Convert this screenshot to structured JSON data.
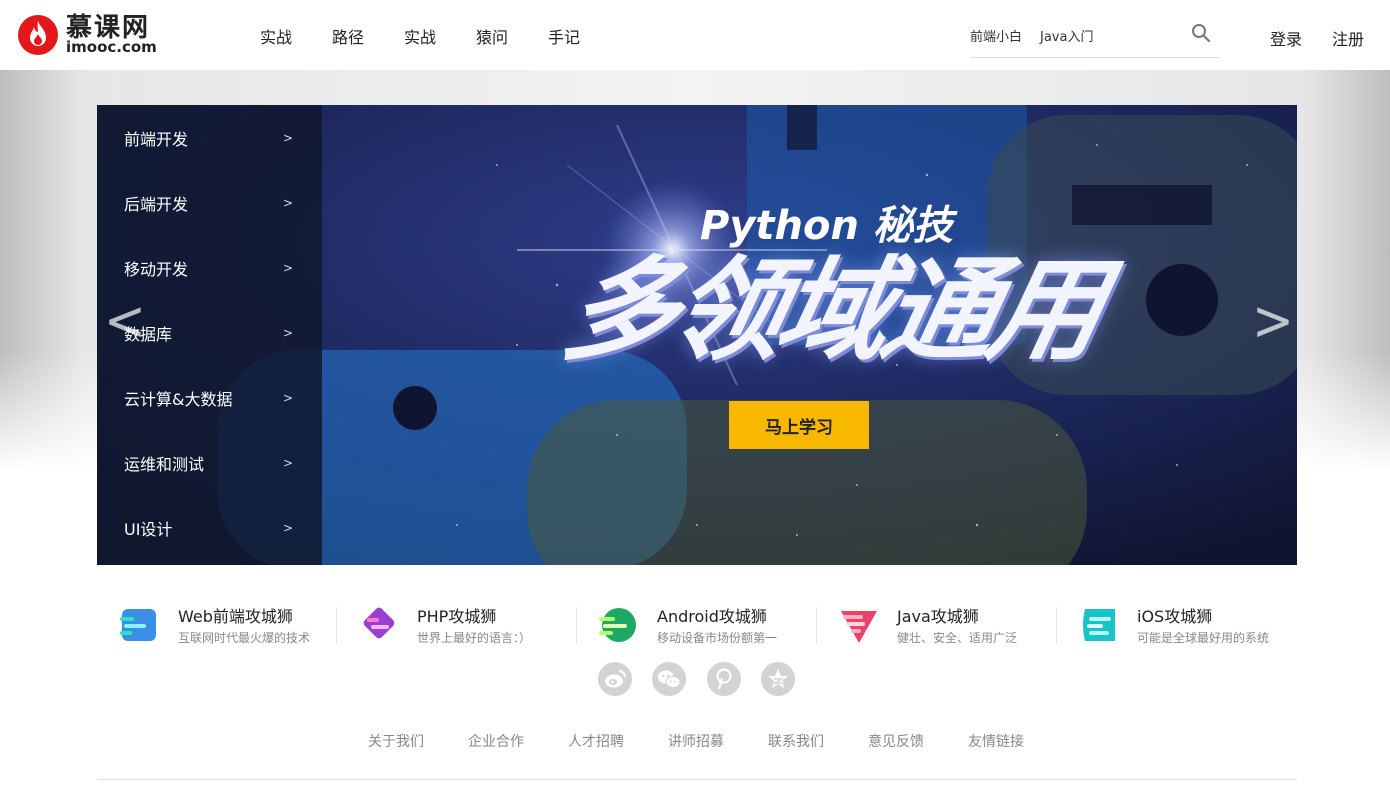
{
  "header": {
    "logo_cn": "慕课网",
    "logo_en": "imooc.com",
    "nav": [
      "实战",
      "路径",
      "实战",
      "猿问",
      "手记"
    ],
    "search": {
      "hot_tags": [
        "前端小白",
        "Java入门"
      ],
      "placeholder": ""
    },
    "login": "登录",
    "register": "注册"
  },
  "sidebar": {
    "items": [
      {
        "label": "前端开发",
        "arrow": ">"
      },
      {
        "label": "后端开发",
        "arrow": ">"
      },
      {
        "label": "移动开发",
        "arrow": ">"
      },
      {
        "label": "数据库",
        "arrow": ">"
      },
      {
        "label": "云计算&大数据",
        "arrow": ">"
      },
      {
        "label": "运维和测试",
        "arrow": ">"
      },
      {
        "label": "UI设计",
        "arrow": ">"
      }
    ]
  },
  "banner": {
    "title": "Python 秘技",
    "headline": "多领域通用",
    "cta": "马上学习",
    "prev": "<",
    "next": ">"
  },
  "paths": [
    {
      "title": "Web前端攻城狮",
      "desc": "互联网时代最火爆的技术",
      "color": "#3a8ee6"
    },
    {
      "title": "PHP攻城狮",
      "desc": "世界上最好的语言：）",
      "color": "#9b3fd1"
    },
    {
      "title": "Android攻城狮",
      "desc": "移动设备市场份额第一",
      "color": "#1ea866"
    },
    {
      "title": "Java攻城狮",
      "desc": "健壮、安全、适用广泛",
      "color": "#e8446a"
    },
    {
      "title": "iOS攻城狮",
      "desc": "可能是全球最好用的系统",
      "color": "#19c3c7"
    }
  ],
  "social": [
    "weibo-icon",
    "wechat-icon",
    "pinterest-icon",
    "qzone-icon"
  ],
  "footer": {
    "links": [
      "关于我们",
      "企业合作",
      "人才招聘",
      "讲师招募",
      "联系我们",
      "意见反馈",
      "友情链接"
    ]
  }
}
